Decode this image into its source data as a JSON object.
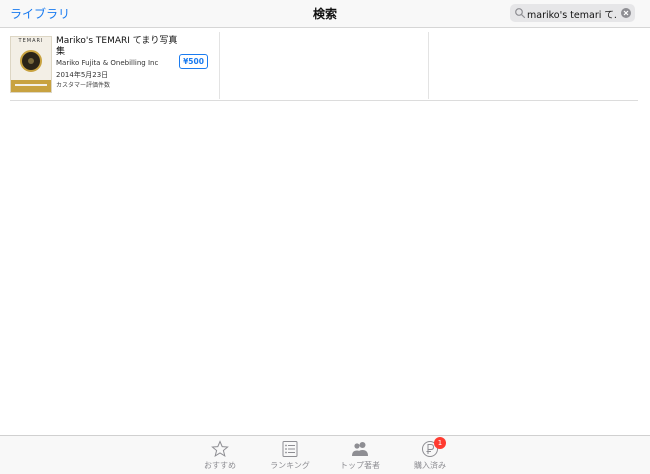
{
  "navbar": {
    "back_label": "ライブラリ",
    "title": "検索",
    "search_value": "mariko's temari て..."
  },
  "results": [
    {
      "icon": {
        "title": "TEMARI",
        "band_text": "TEMARI"
      },
      "name": "Mariko's TEMARI てまり写真集",
      "seller": "Mariko Fujita & Onebilling Inc",
      "date": "2014年5月23日",
      "rating": "カスタマー評価件数",
      "price": "¥500"
    }
  ],
  "tabbar": {
    "tabs": [
      {
        "label": "おすすめ",
        "icon": "star-icon"
      },
      {
        "label": "ランキング",
        "icon": "list-icon"
      },
      {
        "label": "トップ著者",
        "icon": "people-icon"
      },
      {
        "label": "購入済み",
        "icon": "purchased-icon",
        "badge": "1"
      }
    ]
  },
  "colors": {
    "accent": "#1a7bf0",
    "badge": "#ff3b30",
    "tab_inactive": "#8e8e93"
  }
}
